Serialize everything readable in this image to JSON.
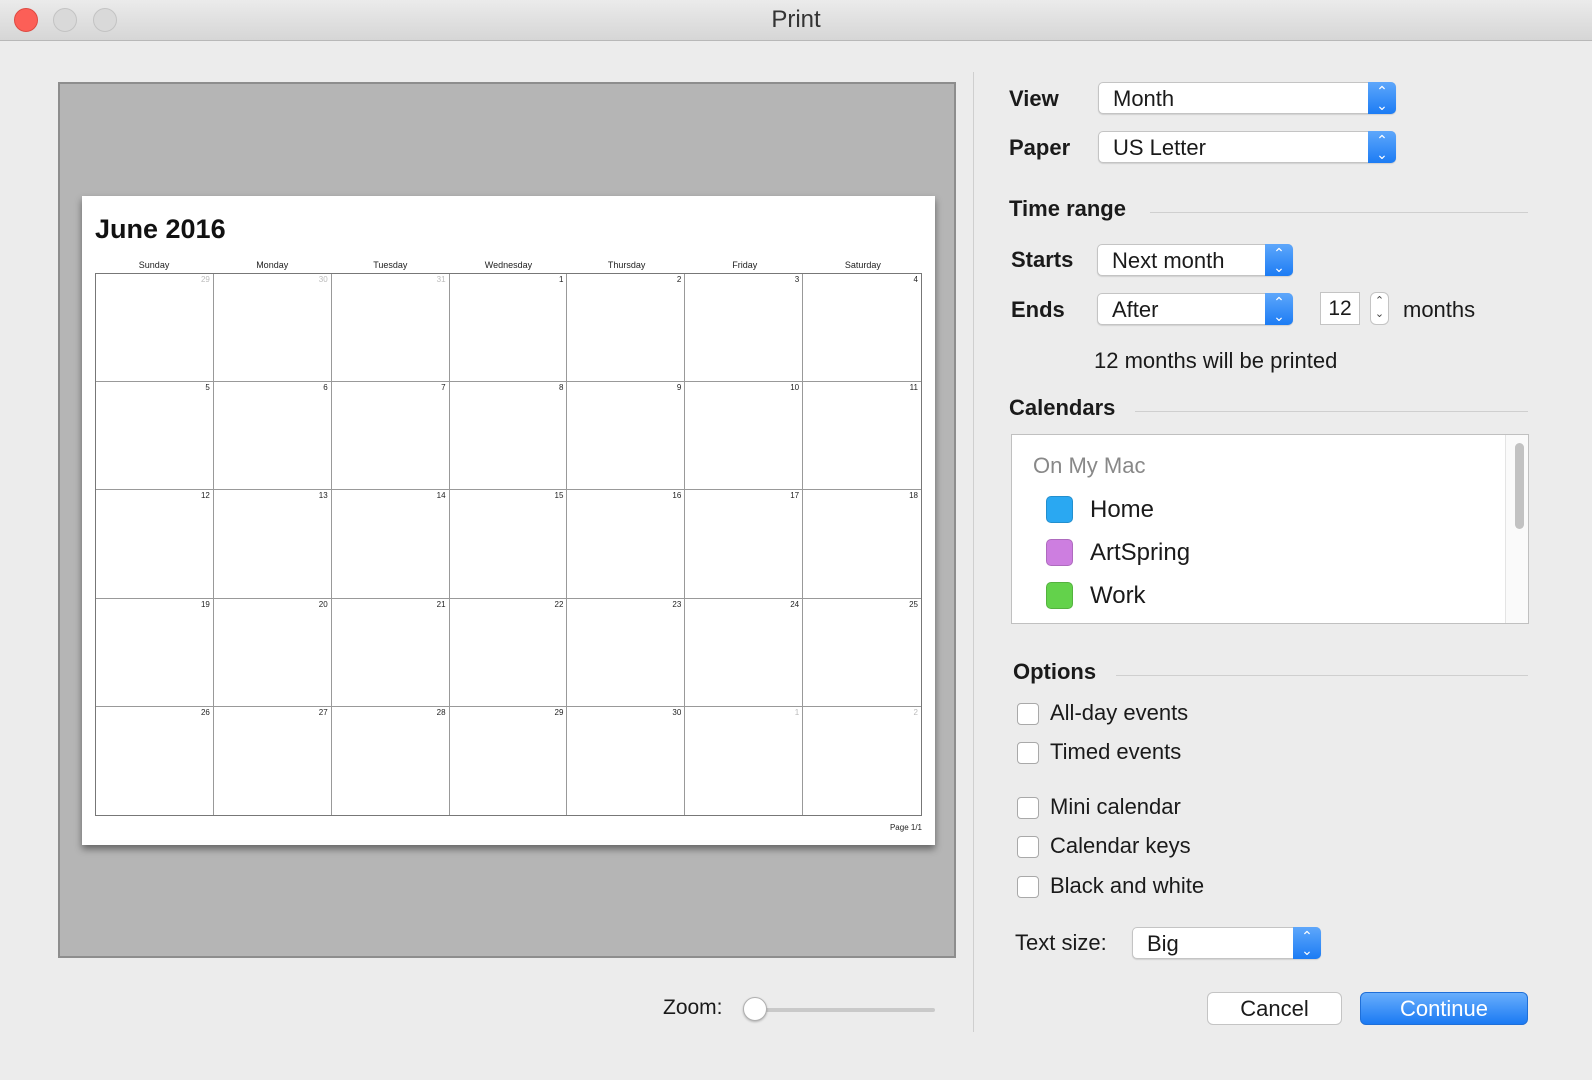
{
  "window": {
    "title": "Print"
  },
  "preview": {
    "month_title": "June 2016",
    "weekdays": [
      "Sunday",
      "Monday",
      "Tuesday",
      "Wednesday",
      "Thursday",
      "Friday",
      "Saturday"
    ],
    "weeks": [
      [
        {
          "d": "29",
          "dim": true
        },
        {
          "d": "30",
          "dim": true
        },
        {
          "d": "31",
          "dim": true
        },
        {
          "d": "1"
        },
        {
          "d": "2"
        },
        {
          "d": "3"
        },
        {
          "d": "4"
        }
      ],
      [
        {
          "d": "5"
        },
        {
          "d": "6"
        },
        {
          "d": "7"
        },
        {
          "d": "8"
        },
        {
          "d": "9"
        },
        {
          "d": "10"
        },
        {
          "d": "11"
        }
      ],
      [
        {
          "d": "12"
        },
        {
          "d": "13"
        },
        {
          "d": "14"
        },
        {
          "d": "15"
        },
        {
          "d": "16"
        },
        {
          "d": "17"
        },
        {
          "d": "18"
        }
      ],
      [
        {
          "d": "19"
        },
        {
          "d": "20"
        },
        {
          "d": "21"
        },
        {
          "d": "22"
        },
        {
          "d": "23"
        },
        {
          "d": "24"
        },
        {
          "d": "25"
        }
      ],
      [
        {
          "d": "26"
        },
        {
          "d": "27"
        },
        {
          "d": "28"
        },
        {
          "d": "29"
        },
        {
          "d": "30"
        },
        {
          "d": "1",
          "dim": true
        },
        {
          "d": "2",
          "dim": true
        }
      ]
    ],
    "footer": "Page 1/1"
  },
  "zoom": {
    "label": "Zoom:",
    "level": 0
  },
  "view": {
    "label": "View",
    "value": "Month"
  },
  "paper": {
    "label": "Paper",
    "value": "US Letter"
  },
  "time_range": {
    "heading": "Time range",
    "starts_label": "Starts",
    "starts_value": "Next month",
    "ends_label": "Ends",
    "ends_value": "After",
    "count": "12",
    "unit": "months",
    "summary": "12 months will be printed"
  },
  "calendars": {
    "heading": "Calendars",
    "group": "On My Mac",
    "items": [
      {
        "name": "Home",
        "color": "#2aa8f2"
      },
      {
        "name": "ArtSpring",
        "color": "#cd7ee0"
      },
      {
        "name": "Work",
        "color": "#63d24b"
      }
    ]
  },
  "options": {
    "heading": "Options",
    "all_day": "All-day events",
    "timed": "Timed events",
    "mini_calendar": "Mini calendar",
    "calendar_keys": "Calendar keys",
    "black_white": "Black and white",
    "text_size_label": "Text size:",
    "text_size_value": "Big"
  },
  "buttons": {
    "cancel": "Cancel",
    "continue": "Continue"
  },
  "icons": {
    "popup": "up-down-chevron-icon",
    "stepper": "stepper-icon"
  }
}
